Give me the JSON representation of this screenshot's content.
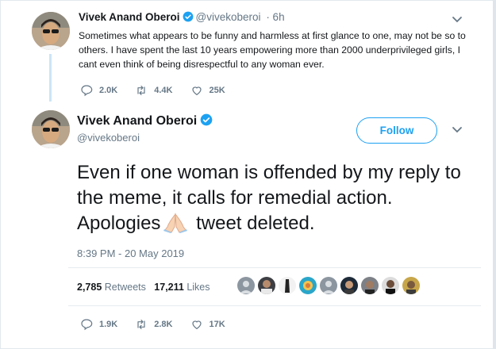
{
  "reply_tweet": {
    "name": "Vivek Anand Oberoi",
    "handle": "@vivekoberoi",
    "time": "· 6h",
    "text": "Sometimes what appears to be funny and harmless at first glance to one, may not be so to others. I have spent the last 10 years empowering more than 2000 underprivileged girls, I cant even think of being disrespectful to any woman ever.",
    "replies": "2.0K",
    "retweets": "4.4K",
    "likes": "25K"
  },
  "main_tweet": {
    "name": "Vivek Anand Oberoi",
    "handle": "@vivekoberoi",
    "follow_label": "Follow",
    "text_before_emoji": "Even if one woman is offended by my reply to the meme, it calls for remedial action. Apologies",
    "emoji": "folded-hands-emoji",
    "text_after_emoji": " tweet deleted.",
    "timestamp": "8:39 PM - 20 May 2019",
    "retweet_count": "2,785",
    "retweet_label": "Retweets",
    "like_count": "17,211",
    "like_label": "Likes",
    "replies": "1.9K",
    "retweets": "2.8K",
    "likes": "17K"
  },
  "colors": {
    "brand": "#1da1f2",
    "muted": "#657786",
    "text": "#14171a",
    "thread_line": "#cce5f4"
  }
}
